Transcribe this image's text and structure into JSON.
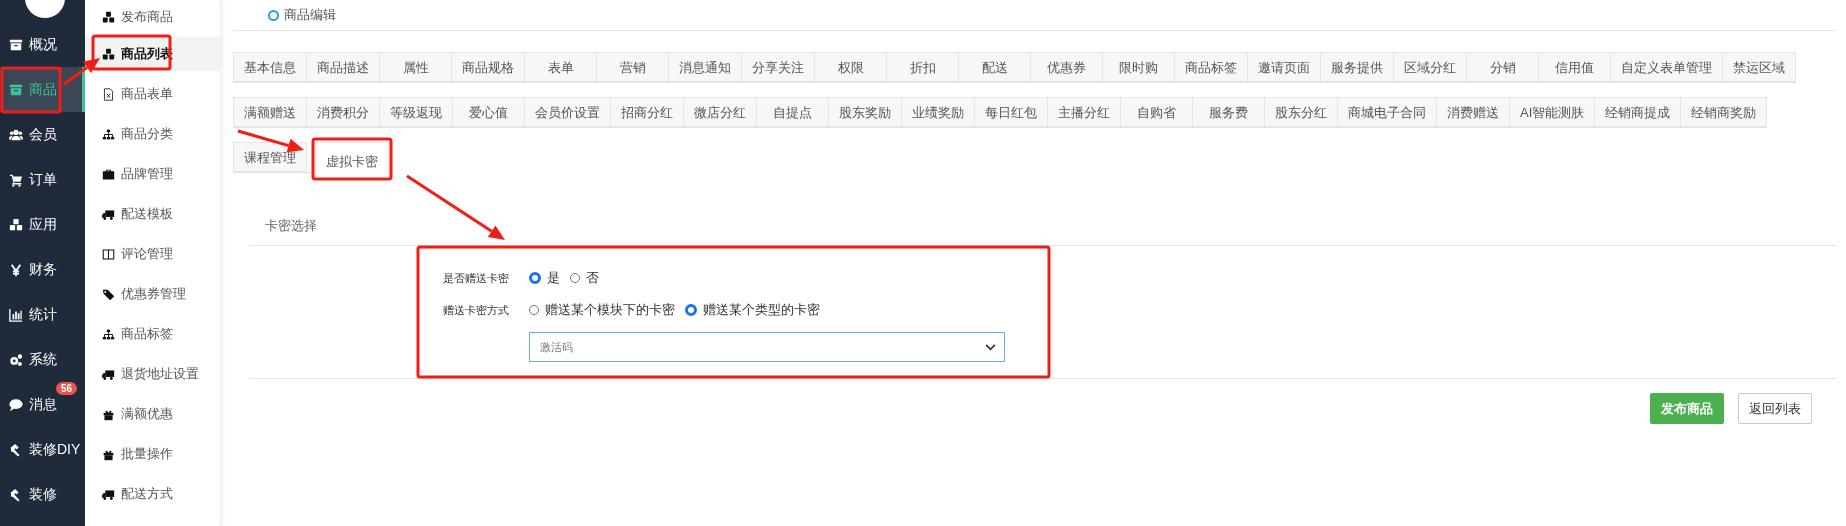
{
  "sidebar": {
    "items": [
      {
        "label": "概况",
        "selected": false
      },
      {
        "label": "商品",
        "selected": true
      },
      {
        "label": "会员",
        "selected": false
      },
      {
        "label": "订单",
        "selected": false
      },
      {
        "label": "应用",
        "selected": false
      },
      {
        "label": "财务",
        "selected": false
      },
      {
        "label": "统计",
        "selected": false
      },
      {
        "label": "系统",
        "selected": false
      },
      {
        "label": "消息",
        "selected": false,
        "badge": "56"
      },
      {
        "label": "装修DIY",
        "selected": false
      },
      {
        "label": "装修",
        "selected": false
      }
    ]
  },
  "submenu": {
    "items": [
      {
        "label": "发布商品",
        "selected": false
      },
      {
        "label": "商品列表",
        "selected": true
      },
      {
        "label": "商品表单",
        "selected": false
      },
      {
        "label": "商品分类",
        "selected": false
      },
      {
        "label": "品牌管理",
        "selected": false
      },
      {
        "label": "配送模板",
        "selected": false
      },
      {
        "label": "评论管理",
        "selected": false
      },
      {
        "label": "优惠券管理",
        "selected": false
      },
      {
        "label": "商品标签",
        "selected": false
      },
      {
        "label": "退货地址设置",
        "selected": false
      },
      {
        "label": "满额优惠",
        "selected": false
      },
      {
        "label": "批量操作",
        "selected": false
      },
      {
        "label": "配送方式",
        "selected": false
      }
    ]
  },
  "page_header": {
    "title": "商品编辑"
  },
  "tab_rows": [
    {
      "tabs": [
        {
          "label": "基本信息",
          "selected": false
        },
        {
          "label": "商品描述",
          "selected": false
        },
        {
          "label": "属性",
          "selected": false
        },
        {
          "label": "商品规格",
          "selected": false
        },
        {
          "label": "表单",
          "selected": false
        },
        {
          "label": "营销",
          "selected": false
        },
        {
          "label": "消息通知",
          "selected": false
        },
        {
          "label": "分享关注",
          "selected": false
        },
        {
          "label": "权限",
          "selected": false
        },
        {
          "label": "折扣",
          "selected": false
        },
        {
          "label": "配送",
          "selected": false
        },
        {
          "label": "优惠券",
          "selected": false
        },
        {
          "label": "限时购",
          "selected": false
        },
        {
          "label": "商品标签",
          "selected": false
        },
        {
          "label": "邀请页面",
          "selected": false
        },
        {
          "label": "服务提供",
          "selected": false
        },
        {
          "label": "区域分红",
          "selected": false
        },
        {
          "label": "分销",
          "selected": false
        },
        {
          "label": "信用值",
          "selected": false
        },
        {
          "label": "自定义表单管理",
          "selected": false
        },
        {
          "label": "禁运区域",
          "selected": false
        }
      ]
    },
    {
      "tabs": [
        {
          "label": "满额赠送",
          "selected": false
        },
        {
          "label": "消费积分",
          "selected": false
        },
        {
          "label": "等级返现",
          "selected": false
        },
        {
          "label": "爱心值",
          "selected": false
        },
        {
          "label": "会员价设置",
          "selected": false
        },
        {
          "label": "招商分红",
          "selected": false
        },
        {
          "label": "微店分红",
          "selected": false
        },
        {
          "label": "自提点",
          "selected": false
        },
        {
          "label": "股东奖励",
          "selected": false
        },
        {
          "label": "业绩奖励",
          "selected": false
        },
        {
          "label": "每日红包",
          "selected": false
        },
        {
          "label": "主播分红",
          "selected": false
        },
        {
          "label": "自购省",
          "selected": false
        },
        {
          "label": "服务费",
          "selected": false
        },
        {
          "label": "股东分红",
          "selected": false
        },
        {
          "label": "商城电子合同",
          "selected": false
        },
        {
          "label": "消费赠送",
          "selected": false
        },
        {
          "label": "AI智能测肤",
          "selected": false
        },
        {
          "label": "经销商提成",
          "selected": false
        },
        {
          "label": "经销商奖励",
          "selected": false
        }
      ]
    },
    {
      "tabs": [
        {
          "label": "课程管理",
          "selected": false
        },
        {
          "label": "虚拟卡密",
          "selected": true
        }
      ]
    }
  ],
  "section": {
    "title": "卡密选择"
  },
  "form": {
    "fields": [
      {
        "kind": "radio",
        "label": "是否赠送卡密",
        "options": [
          {
            "label": "是",
            "selected": true
          },
          {
            "label": "否",
            "selected": false
          }
        ]
      },
      {
        "kind": "radio",
        "label": "赠送卡密方式",
        "options": [
          {
            "label": "赠送某个模块下的卡密",
            "selected": false
          },
          {
            "label": "赠送某个类型的卡密",
            "selected": true
          }
        ]
      },
      {
        "kind": "select",
        "value": "激活码"
      }
    ]
  },
  "buttons": [
    {
      "label": "发布商品",
      "kind": "primary"
    },
    {
      "label": "返回列表",
      "kind": "default"
    }
  ]
}
